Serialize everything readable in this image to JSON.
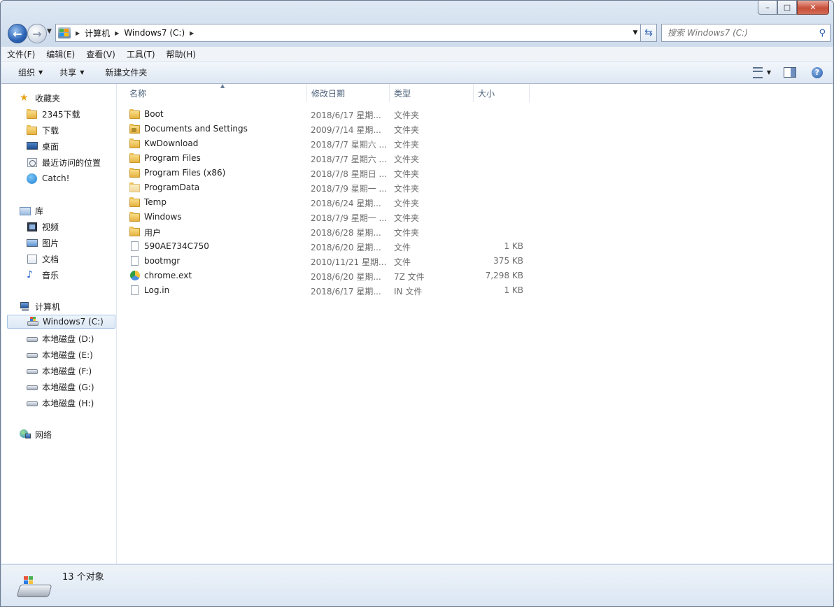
{
  "window": {
    "min_label": "▭",
    "max_label": "□",
    "close_label": "✕"
  },
  "nav": {
    "back_icon": "back-arrow-icon",
    "forward_icon": "forward-arrow-icon",
    "crumbs": [
      "计算机",
      "Windows7 (C:)"
    ],
    "search_placeholder": "搜索 Windows7 (C:)"
  },
  "menu": [
    "文件(F)",
    "编辑(E)",
    "查看(V)",
    "工具(T)",
    "帮助(H)"
  ],
  "commands": {
    "organize": "组织",
    "share": "共享",
    "new_folder": "新建文件夹"
  },
  "sidebar": {
    "favorites": {
      "label": "收藏夹",
      "items": [
        "2345下载",
        "下载",
        "桌面",
        "最近访问的位置",
        "Catch!"
      ]
    },
    "libraries": {
      "label": "库",
      "items": [
        "视频",
        "图片",
        "文档",
        "音乐"
      ]
    },
    "computer": {
      "label": "计算机",
      "items": [
        "Windows7 (C:)",
        "本地磁盘 (D:)",
        "本地磁盘 (E:)",
        "本地磁盘 (F:)",
        "本地磁盘 (G:)",
        "本地磁盘 (H:)"
      ]
    },
    "network": {
      "label": "网络"
    }
  },
  "columns": {
    "name": "名称",
    "date": "修改日期",
    "type": "类型",
    "size": "大小"
  },
  "files": [
    {
      "name": "Boot",
      "date": "2018/6/17 星期...",
      "type": "文件夹",
      "size": "",
      "icon": "folder"
    },
    {
      "name": "Documents and Settings",
      "date": "2009/7/14 星期...",
      "type": "文件夹",
      "size": "",
      "icon": "folder-locked"
    },
    {
      "name": "KwDownload",
      "date": "2018/7/7 星期六 ...",
      "type": "文件夹",
      "size": "",
      "icon": "folder"
    },
    {
      "name": "Program Files",
      "date": "2018/7/7 星期六 ...",
      "type": "文件夹",
      "size": "",
      "icon": "folder"
    },
    {
      "name": "Program Files (x86)",
      "date": "2018/7/8 星期日 ...",
      "type": "文件夹",
      "size": "",
      "icon": "folder"
    },
    {
      "name": "ProgramData",
      "date": "2018/7/9 星期一 ...",
      "type": "文件夹",
      "size": "",
      "icon": "folder-faded"
    },
    {
      "name": "Temp",
      "date": "2018/6/24 星期...",
      "type": "文件夹",
      "size": "",
      "icon": "folder"
    },
    {
      "name": "Windows",
      "date": "2018/7/9 星期一 ...",
      "type": "文件夹",
      "size": "",
      "icon": "folder"
    },
    {
      "name": "用户",
      "date": "2018/6/28 星期...",
      "type": "文件夹",
      "size": "",
      "icon": "folder"
    },
    {
      "name": "590AE734C750",
      "date": "2018/6/20 星期...",
      "type": "文件",
      "size": "1 KB",
      "icon": "file"
    },
    {
      "name": "bootmgr",
      "date": "2010/11/21 星期...",
      "type": "文件",
      "size": "375 KB",
      "icon": "file"
    },
    {
      "name": "chrome.ext",
      "date": "2018/6/20 星期...",
      "type": "7Z 文件",
      "size": "7,298 KB",
      "icon": "app"
    },
    {
      "name": "Log.in",
      "date": "2018/6/17 星期...",
      "type": "IN 文件",
      "size": "1 KB",
      "icon": "file"
    }
  ],
  "status": {
    "count": "13 个对象"
  }
}
